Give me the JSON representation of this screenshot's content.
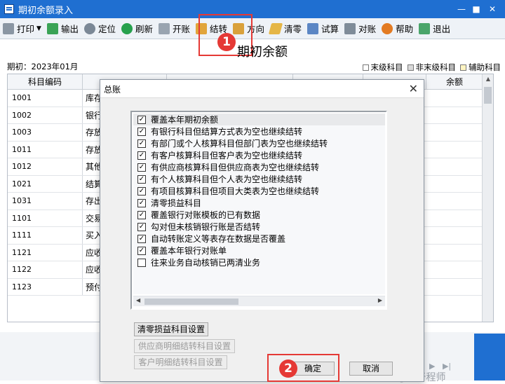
{
  "window": {
    "title": "期初余额录入"
  },
  "toolbar": [
    {
      "label": "打印",
      "icon": "printer-icon",
      "has_dropdown": true
    },
    {
      "label": "输出",
      "icon": "export-icon"
    },
    {
      "label": "定位",
      "icon": "locate-icon"
    },
    {
      "label": "刷新",
      "icon": "refresh-icon"
    },
    {
      "label": "开账",
      "icon": "open-ledger-icon"
    },
    {
      "label": "结转",
      "icon": "carry-forward-icon"
    },
    {
      "label": "方向",
      "icon": "direction-icon"
    },
    {
      "label": "清零",
      "icon": "clear-icon"
    },
    {
      "label": "试算",
      "icon": "trial-balance-icon"
    },
    {
      "label": "对账",
      "icon": "reconcile-icon"
    },
    {
      "label": "帮助",
      "icon": "help-icon"
    },
    {
      "label": "退出",
      "icon": "exit-icon"
    }
  ],
  "page": {
    "title": "期初余额",
    "period": "期初：2023年01月",
    "legend": [
      "末级科目",
      "非末级科目",
      "辅助科目"
    ]
  },
  "grid": {
    "columns": [
      "科目编码",
      "",
      "",
      "",
      "",
      "余额"
    ],
    "rows": [
      {
        "code": "1001",
        "name": "库存"
      },
      {
        "code": "1002",
        "name": "银行"
      },
      {
        "code": "1003",
        "name": "存放"
      },
      {
        "code": "1011",
        "name": "存放"
      },
      {
        "code": "1012",
        "name": "其他"
      },
      {
        "code": "1021",
        "name": "结算"
      },
      {
        "code": "1031",
        "name": "存出"
      },
      {
        "code": "1101",
        "name": "交易"
      },
      {
        "code": "1111",
        "name": "买入"
      },
      {
        "code": "1121",
        "name": "应收"
      },
      {
        "code": "1122",
        "name": "应收"
      },
      {
        "code": "1123",
        "name": "预付"
      }
    ]
  },
  "dialog": {
    "title": "总账",
    "options": [
      {
        "label": "覆盖本年期初余额",
        "checked": true
      },
      {
        "label": "有银行科目但结算方式表为空也继续结转",
        "checked": true
      },
      {
        "label": "有部门或个人核算科目但部门表为空也继续结转",
        "checked": true
      },
      {
        "label": "有客户核算科目但客户表为空也继续结转",
        "checked": true
      },
      {
        "label": "有供应商核算科目但供应商表为空也继续结转",
        "checked": true
      },
      {
        "label": "有个人核算科目但个人表为空也继续结转",
        "checked": true
      },
      {
        "label": "有项目核算科目但项目大类表为空也继续结转",
        "checked": true
      },
      {
        "label": "清零损益科目",
        "checked": true
      },
      {
        "label": "覆盖银行对账模板的已有数据",
        "checked": true
      },
      {
        "label": "勾对但未核销银行账是否结转",
        "checked": true
      },
      {
        "label": "自动转账定义等表存在数据是否覆盖",
        "checked": true
      },
      {
        "label": "覆盖本年银行对账单",
        "checked": true
      },
      {
        "label": "往来业务自动核销已两清业务",
        "checked": false
      }
    ],
    "buttons": {
      "clear_pl_settings": "清零损益科目设置",
      "supplier_detail_settings": "供应商明细结转科目设置",
      "customer_detail_settings": "客户明细结转科目设置",
      "ok": "确定",
      "cancel": "取消"
    }
  },
  "annotations": {
    "badge1": "1",
    "badge2": "2"
  },
  "watermark": "知乎 @金于程师",
  "colors": {
    "titlebar": "#1f6fd1",
    "highlight": "#e53935"
  }
}
